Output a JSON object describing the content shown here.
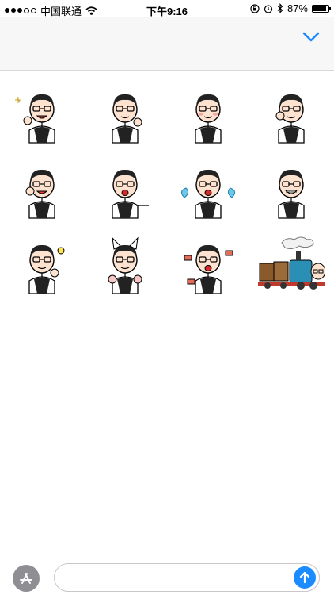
{
  "status_bar": {
    "carrier": "中国联通",
    "time": "下午9:16",
    "battery_percent": "87%",
    "battery_level": 0.87,
    "signal_bars_filled": 3,
    "signal_bars_total": 5
  },
  "header": {
    "collapse_icon": "chevron-down-icon",
    "accent_color": "#1a8cff"
  },
  "stickers": [
    {
      "id": "sticker-1",
      "pose": "thumbs-up"
    },
    {
      "id": "sticker-2",
      "pose": "thinking"
    },
    {
      "id": "sticker-3",
      "pose": "shy"
    },
    {
      "id": "sticker-4",
      "pose": "hand-on-cheek"
    },
    {
      "id": "sticker-5",
      "pose": "laughing"
    },
    {
      "id": "sticker-6",
      "pose": "leaning"
    },
    {
      "id": "sticker-7",
      "pose": "crying"
    },
    {
      "id": "sticker-8",
      "pose": "grinning"
    },
    {
      "id": "sticker-9",
      "pose": "idea"
    },
    {
      "id": "sticker-10",
      "pose": "cat-ears"
    },
    {
      "id": "sticker-11",
      "pose": "money"
    },
    {
      "id": "sticker-12",
      "pose": "train"
    }
  ],
  "compose": {
    "placeholder": "",
    "app_store_icon": "app-store-icon",
    "send_icon": "send-arrow-icon"
  }
}
